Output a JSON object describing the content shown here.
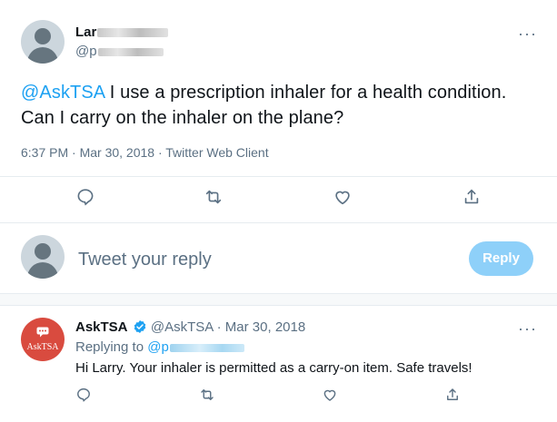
{
  "tweet": {
    "author_name_visible": "Lar",
    "handle_prefix": "@p",
    "mention": "@AskTSA",
    "text": " I use a prescription inhaler for a health condition.  Can I carry on the inhaler on the plane?",
    "timestamp": "6:37 PM · Mar 30, 2018 · Twitter Web Client",
    "more_label": "···",
    "icons": [
      "reply-icon",
      "retweet-icon",
      "like-icon",
      "share-icon"
    ]
  },
  "reply_composer": {
    "placeholder": "Tweet your reply",
    "button_label": "Reply"
  },
  "reply_tweet": {
    "avatar_text": "AskTSA",
    "name": "AskTSA",
    "handle": "@AskTSA",
    "separator": "·",
    "date": "Mar 30, 2018",
    "replying_to_label": "Replying to ",
    "replying_to_prefix": "@p",
    "text": "Hi Larry. Your inhaler is permitted as a carry-on item. Safe travels!",
    "more_label": "···",
    "icons": [
      "reply-icon",
      "retweet-icon",
      "like-icon",
      "share-icon"
    ]
  },
  "colors": {
    "accent": "#1da1f2",
    "reply_button_disabled": "#8ed0f9",
    "muted_text": "#5b7083",
    "asktsa_avatar": "#d94b3f"
  }
}
